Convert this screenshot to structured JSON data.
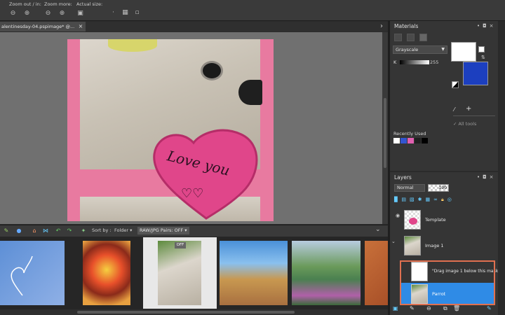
{
  "toolbar": {
    "zoom_out_label": "Zoom out / in:",
    "zoom_more_label": "Zoom more:",
    "actual_size_label": "Actual size:"
  },
  "document": {
    "tab_title": "alentinesday-04.pspimage* @...",
    "close_glyph": "×"
  },
  "artwork": {
    "heart_text_line1": "Love you",
    "heart_color": "#e0468a"
  },
  "organizer": {
    "sort_by_label": "Sort by :",
    "folder_label": "Folder ▾",
    "raw_pairs_label": "RAW/JPG Pairs: OFF ▾",
    "off_badge": "OFF"
  },
  "materials": {
    "title": "Materials",
    "palette_select": "Grayscale",
    "k_label": "K",
    "k_value": "255",
    "all_tools_label": "All tools",
    "recently_used_label": "Recently Used",
    "foreground_color": "#ffffff",
    "background_color": "#1c3fbf",
    "recent_colors": [
      "#ffffff",
      "#3355d0",
      "#e060b0",
      "#202020",
      "#000000"
    ]
  },
  "layers": {
    "title": "Layers",
    "blend_mode": "Normal",
    "opacity": "100",
    "items": [
      {
        "name": "Template"
      },
      {
        "name": "Image 1"
      },
      {
        "name": "\"Drag image 1 below this mask\""
      },
      {
        "name": "Parrot"
      }
    ]
  },
  "colors": {
    "accent_selection": "#2f8be6",
    "highlight_border": "#e07050"
  }
}
